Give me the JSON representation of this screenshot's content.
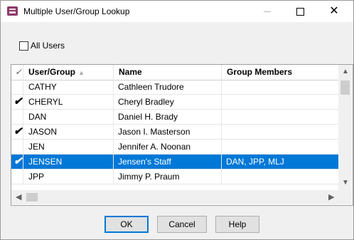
{
  "window": {
    "title": "Multiple User/Group Lookup"
  },
  "controls": {
    "minimize": "—",
    "maximize": "☐",
    "close": "✕"
  },
  "options": {
    "all_users_label": "All Users",
    "all_users_checked": false
  },
  "table": {
    "headers": {
      "check": "✓",
      "user_group": "User/Group",
      "sort_indicator": "▲",
      "name": "Name",
      "group_members": "Group Members"
    },
    "rows": [
      {
        "checked": "",
        "user_group": "CATHY",
        "name": "Cathleen Trudore",
        "group_members": ""
      },
      {
        "checked": "✔",
        "user_group": "CHERYL",
        "name": "Cheryl Bradley",
        "group_members": ""
      },
      {
        "checked": "",
        "user_group": "DAN",
        "name": "Daniel H. Brady",
        "group_members": ""
      },
      {
        "checked": "✔",
        "user_group": "JASON",
        "name": "Jason I. Masterson",
        "group_members": ""
      },
      {
        "checked": "",
        "user_group": "JEN",
        "name": "Jennifer A. Noonan",
        "group_members": ""
      },
      {
        "checked": "✔",
        "user_group": "JENSEN",
        "name": "Jensen's Staff",
        "group_members": "DAN, JPP, MLJ",
        "selected": true
      },
      {
        "checked": "",
        "user_group": "JPP",
        "name": "Jimmy P. Praum",
        "group_members": ""
      }
    ]
  },
  "buttons": {
    "ok": "OK",
    "cancel": "Cancel",
    "help": "Help"
  },
  "colors": {
    "selection": "#0078d7",
    "icon": "#8c3a6b"
  }
}
